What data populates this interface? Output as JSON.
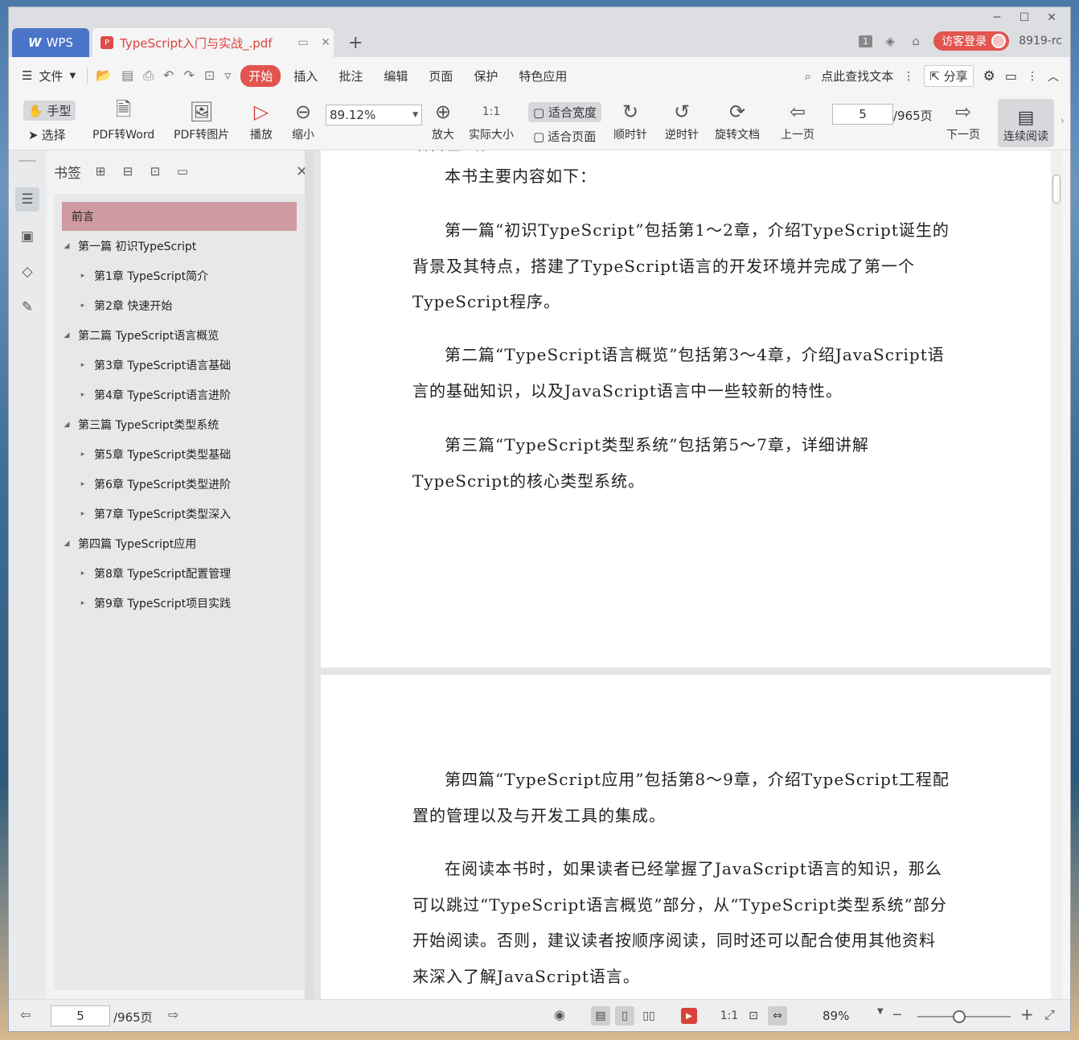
{
  "window": {
    "controls": [
      "minimize",
      "maximize",
      "close"
    ]
  },
  "tabs": {
    "home_label": "WPS",
    "doc_title": "TypeScript入门与实战_.pdf"
  },
  "title_right": {
    "badge": "1",
    "login_label": "访客登录",
    "user_name": "8919-rc"
  },
  "menu": {
    "file_label": "文件",
    "tabs": [
      "开始",
      "插入",
      "批注",
      "编辑",
      "页面",
      "保护",
      "特色应用"
    ],
    "search_label": "点此查找文本",
    "share_label": "分享"
  },
  "toolbar": {
    "hand_label": "手型",
    "select_label": "选择",
    "pdf_word_label": "PDF转Word",
    "pdf_image_label": "PDF转图片",
    "play_label": "播放",
    "zoom_out_label": "缩小",
    "zoom_value": "89.12%",
    "zoom_in_label": "放大",
    "actual_size_label": "实际大小",
    "fit_width_label": "适合宽度",
    "fit_page_label": "适合页面",
    "clockwise_label": "顺时针",
    "counter_label": "逆时针",
    "rotate_doc_label": "旋转文档",
    "prev_page_label": "上一页",
    "current_page": "5",
    "page_total": "/965页",
    "next_page_label": "下一页",
    "continuous_label": "连续阅读"
  },
  "bookmarks": {
    "title": "书签",
    "items": [
      {
        "label": "前言",
        "level": 0,
        "arrow": "",
        "selected": true
      },
      {
        "label": "第一篇 初识TypeScript",
        "level": 0,
        "arrow": "◢"
      },
      {
        "label": "第1章 TypeScript简介",
        "level": 1,
        "arrow": "▸"
      },
      {
        "label": "第2章 快速开始",
        "level": 1,
        "arrow": "▸"
      },
      {
        "label": "第二篇 TypeScript语言概览",
        "level": 0,
        "arrow": "◢"
      },
      {
        "label": "第3章 TypeScript语言基础",
        "level": 1,
        "arrow": "▸"
      },
      {
        "label": "第4章 TypeScript语言进阶",
        "level": 1,
        "arrow": "▸"
      },
      {
        "label": "第三篇 TypeScript类型系统",
        "level": 0,
        "arrow": "◢"
      },
      {
        "label": "第5章 TypeScript类型基础",
        "level": 1,
        "arrow": "▸"
      },
      {
        "label": "第6章 TypeScript类型进阶",
        "level": 1,
        "arrow": "▸"
      },
      {
        "label": "第7章 TypeScript类型深入",
        "level": 1,
        "arrow": "▸"
      },
      {
        "label": "第四篇 TypeScript应用",
        "level": 0,
        "arrow": "◢"
      },
      {
        "label": "第8章 TypeScript配置管理",
        "level": 1,
        "arrow": "▸"
      },
      {
        "label": "第9章 TypeScript项目实践",
        "level": 1,
        "arrow": "▸"
      }
    ]
  },
  "document": {
    "page1_partial": "语言基础。",
    "p1": "本书主要内容如下：",
    "p2": "第一篇“初识TypeScript”包括第1～2章，介绍TypeScript诞生的背景及其特点，搭建了TypeScript语言的开发环境并完成了第一个TypeScript程序。",
    "p3": "第二篇“TypeScript语言概览”包括第3～4章，介绍JavaScript语言的基础知识，以及JavaScript语言中一些较新的特性。",
    "p4": "第三篇“TypeScript类型系统”包括第5～7章，详细讲解TypeScript的核心类型系统。",
    "p5": "第四篇“TypeScript应用”包括第8～9章，介绍TypeScript工程配置的管理以及与开发工具的集成。",
    "p6": "在阅读本书时，如果读者已经掌握了JavaScript语言的知识，那么可以跳过“TypeScript语言概览”部分，从“TypeScript类型系统”部分开始阅读。否则，建议读者按顺序阅读，同时还可以配合使用其他资料来深入了解JavaScript语言。"
  },
  "status": {
    "current_page": "5",
    "page_total": "/965页",
    "zoom_label": "89%",
    "zoom_fraction": 0.45
  },
  "colors": {
    "accent": "#e2544e",
    "wps_blue": "#4a74c8",
    "bookmark_selected": "#cf9aa2"
  }
}
